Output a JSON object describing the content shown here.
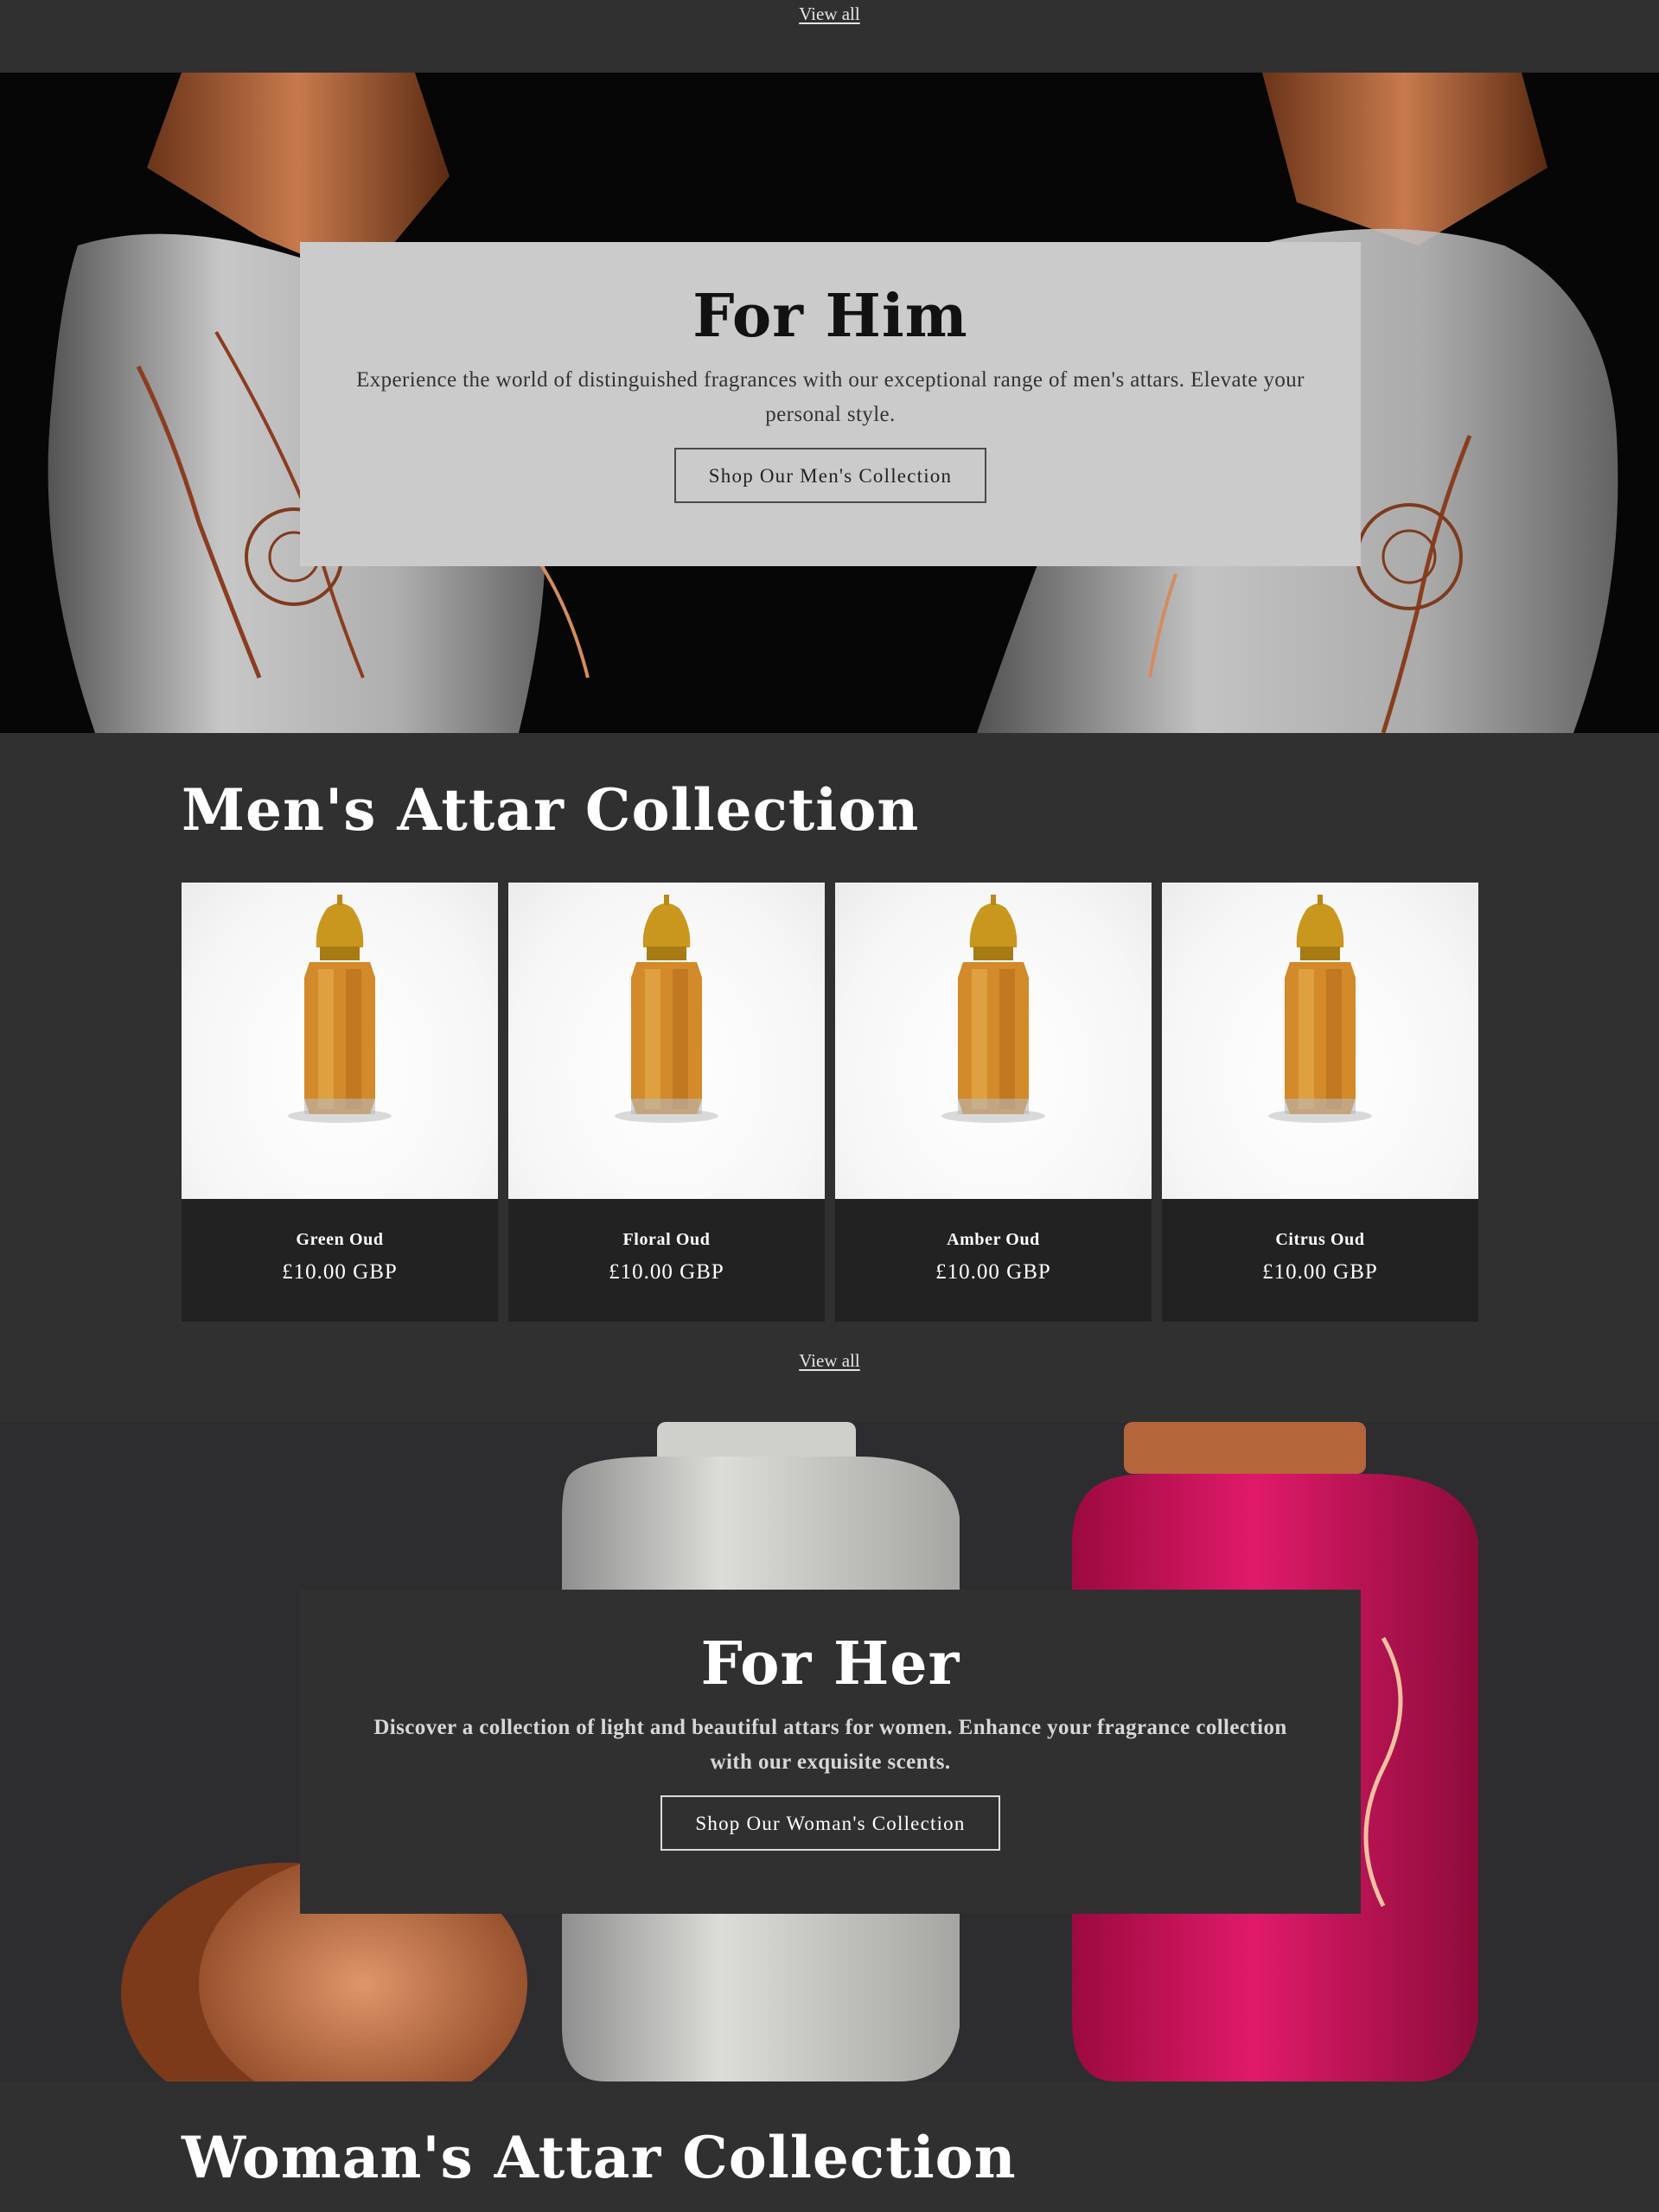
{
  "top": {
    "view_all": "View all"
  },
  "hero_him": {
    "title": "For Him",
    "text": "Experience the world of distinguished fragrances with our exceptional range of men's attars. Elevate your personal style.",
    "button": "Shop Our Men's Collection"
  },
  "mens_collection": {
    "title": "Men's Attar Collection",
    "products": [
      {
        "name": "Green Oud",
        "price": "£10.00 GBP"
      },
      {
        "name": "Floral Oud",
        "price": "£10.00 GBP"
      },
      {
        "name": "Amber Oud",
        "price": "£10.00 GBP"
      },
      {
        "name": "Citrus Oud",
        "price": "£10.00 GBP"
      }
    ],
    "view_all": "View all"
  },
  "hero_her": {
    "title": "For Her",
    "text": "Discover a collection of light and beautiful attars for women. Enhance your fragrance collection with our exquisite scents.",
    "button": "Shop Our Woman's Collection"
  },
  "womens_collection": {
    "title": "Woman's Attar Collection"
  },
  "colors": {
    "page_bg": "#303030",
    "card_info_bg": "#222222",
    "him_card_bg": "#cbcbcb",
    "copper": "#b5653a",
    "pink": "#d0105a"
  }
}
